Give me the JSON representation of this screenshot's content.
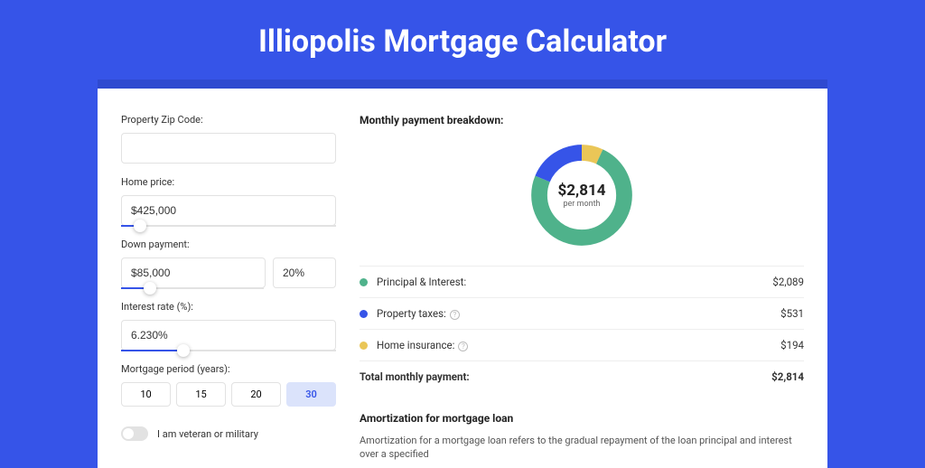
{
  "title": "Illiopolis Mortgage Calculator",
  "form": {
    "zip_label": "Property Zip Code:",
    "zip_value": "",
    "home_price_label": "Home price:",
    "home_price_value": "$425,000",
    "home_price_slider_pct": 9,
    "down_payment_label": "Down payment:",
    "down_payment_value": "$85,000",
    "down_payment_pct_value": "20%",
    "down_payment_slider_pct": 20,
    "rate_label": "Interest rate (%):",
    "rate_value": "6.230%",
    "rate_slider_pct": 29,
    "period_label": "Mortgage period (years):",
    "periods": [
      "10",
      "15",
      "20",
      "30"
    ],
    "period_active_index": 3,
    "veteran_label": "I am veteran or military"
  },
  "breakdown": {
    "title": "Monthly payment breakdown:",
    "total_amount": "$2,814",
    "per_month": "per month",
    "items": [
      {
        "label": "Principal & Interest:",
        "value": "$2,089",
        "color": "#4fb28b",
        "has_info": false
      },
      {
        "label": "Property taxes:",
        "value": "$531",
        "color": "#3654e8",
        "has_info": true
      },
      {
        "label": "Home insurance:",
        "value": "$194",
        "color": "#eac657",
        "has_info": true
      }
    ],
    "total_label": "Total monthly payment:",
    "total_value": "$2,814"
  },
  "chart_data": {
    "type": "pie",
    "title": "Monthly payment breakdown",
    "series": [
      {
        "name": "Principal & Interest",
        "value": 2089,
        "color": "#4fb28b"
      },
      {
        "name": "Property taxes",
        "value": 531,
        "color": "#3654e8"
      },
      {
        "name": "Home insurance",
        "value": 194,
        "color": "#eac657"
      }
    ],
    "total": 2814,
    "center_label": "$2,814",
    "center_sub": "per month"
  },
  "amortization": {
    "title": "Amortization for mortgage loan",
    "text": "Amortization for a mortgage loan refers to the gradual repayment of the loan principal and interest over a specified"
  }
}
